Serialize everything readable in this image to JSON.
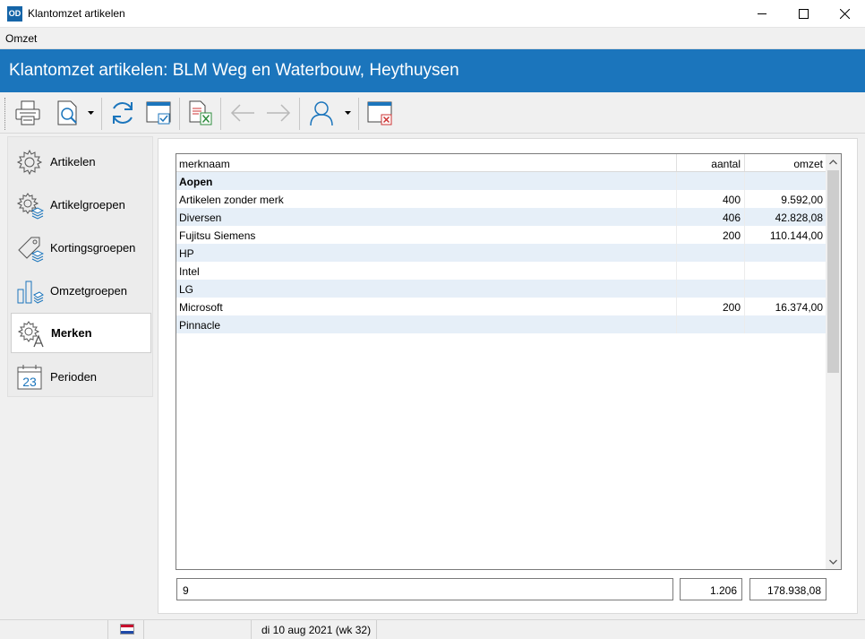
{
  "window": {
    "icon_text": "OD",
    "title": "Klantomzet artikelen"
  },
  "menu": {
    "items": [
      "Omzet"
    ]
  },
  "banner": {
    "title": "Klantomzet artikelen: BLM Weg en Waterbouw, Heythuysen",
    "color": "#1b75bc"
  },
  "toolbar": {
    "buttons": [
      {
        "icon": "printer-icon"
      },
      {
        "icon": "print-preview-icon"
      },
      {
        "icon": "refresh-icon"
      },
      {
        "icon": "select-window-icon"
      },
      {
        "icon": "export-excel-icon"
      },
      {
        "icon": "back-arrow-icon"
      },
      {
        "icon": "forward-arrow-icon"
      },
      {
        "icon": "customer-icon"
      },
      {
        "icon": "close-window-icon"
      }
    ]
  },
  "sidebar": {
    "items": [
      {
        "label": "Artikelen",
        "icon": "gear-icon"
      },
      {
        "label": "Artikelgroepen",
        "icon": "gear-stack-icon"
      },
      {
        "label": "Kortingsgroepen",
        "icon": "tag-icon"
      },
      {
        "label": "Omzetgroepen",
        "icon": "bar-chart-icon"
      },
      {
        "label": "Merken",
        "icon": "gear-brand-icon",
        "active": true
      },
      {
        "label": "Perioden",
        "icon": "calendar-icon",
        "day": "23"
      }
    ]
  },
  "grid": {
    "columns": [
      "merknaam",
      "aantal",
      "omzet"
    ],
    "rows": [
      {
        "name": "Aopen",
        "aantal": "",
        "omzet": "",
        "bold": true
      },
      {
        "name": "Artikelen zonder merk",
        "aantal": "400",
        "omzet": "9.592,00"
      },
      {
        "name": "Diversen",
        "aantal": "406",
        "omzet": "42.828,08"
      },
      {
        "name": "Fujitsu Siemens",
        "aantal": "200",
        "omzet": "110.144,00"
      },
      {
        "name": "HP",
        "aantal": "",
        "omzet": ""
      },
      {
        "name": "Intel",
        "aantal": "",
        "omzet": ""
      },
      {
        "name": "LG",
        "aantal": "",
        "omzet": ""
      },
      {
        "name": "Microsoft",
        "aantal": "200",
        "omzet": "16.374,00"
      },
      {
        "name": "Pinnacle",
        "aantal": "",
        "omzet": ""
      }
    ]
  },
  "totals": {
    "count": "9",
    "aantal": "1.206",
    "omzet": "178.938,08"
  },
  "statusbar": {
    "flag_icon": "netherlands-flag-icon",
    "date": "di 10 aug 2021 (wk 32)"
  }
}
